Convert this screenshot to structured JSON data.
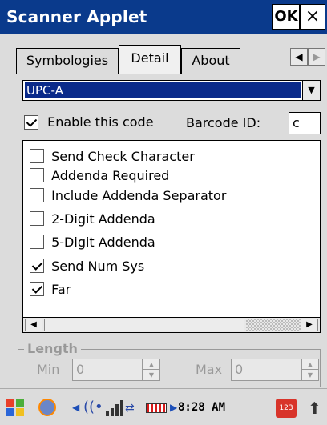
{
  "window": {
    "title": "Scanner Applet",
    "ok_label": "OK",
    "close_label": "×"
  },
  "tabs": [
    {
      "label": "Symbologies",
      "active": false
    },
    {
      "label": "Detail",
      "active": true
    },
    {
      "label": "About",
      "active": false
    }
  ],
  "tab_nav": {
    "left": "◀",
    "right": "▶"
  },
  "symbology": {
    "selected": "UPC-A",
    "arrow": "▼"
  },
  "enable": {
    "label": "Enable this code",
    "checked": true
  },
  "barcode_id": {
    "label": "Barcode ID:",
    "value": "c"
  },
  "options": [
    {
      "label": "Send Check Character",
      "checked": false
    },
    {
      "label": "Addenda Required",
      "checked": false
    },
    {
      "label": "Include Addenda Separator",
      "checked": false
    },
    {
      "label": "2-Digit Addenda",
      "checked": false
    },
    {
      "label": "5-Digit Addenda",
      "checked": false
    },
    {
      "label": "Send Num Sys",
      "checked": true
    },
    {
      "label": "Far",
      "checked": true
    }
  ],
  "scroll": {
    "left": "◀",
    "right": "▶"
  },
  "length": {
    "title": "Length",
    "min_label": "Min",
    "min_value": "0",
    "max_label": "Max",
    "max_value": "0",
    "up": "▲",
    "down": "▼"
  },
  "taskbar": {
    "time": "8:28 AM",
    "arrow_left": "◀",
    "arrow_right": "▶",
    "wifi": "((•",
    "conn": "⇄",
    "keyboard": "123",
    "up": "⬆"
  }
}
